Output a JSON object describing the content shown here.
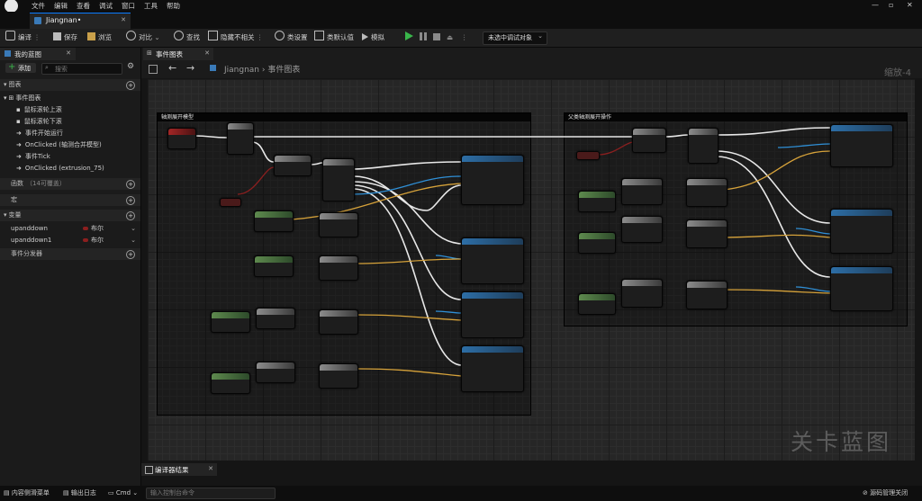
{
  "menu": [
    "文件",
    "编辑",
    "查看",
    "调试",
    "窗口",
    "工具",
    "帮助"
  ],
  "doc_tab": "Jiangnan•",
  "toolbar": {
    "compile": "编译",
    "save": "保存",
    "browse": "浏览",
    "diff": "对比",
    "find": "查找",
    "hide_unrelated": "隐藏不相关",
    "class_settings": "类设置",
    "class_defaults": "类默认值",
    "simulate": "模拟",
    "debug_target": "未选中调试对象"
  },
  "left_panel": {
    "tab_title": "我的蓝图",
    "add_label": "添加",
    "search_placeholder": "搜索",
    "section_graphs": "图表",
    "event_graph": "事件图表",
    "events": [
      "鼠标滚轮上滚",
      "鼠标滚轮下滚",
      "事件开始运行",
      "OnClicked (轴测合并模型)",
      "事件Tick",
      "OnClicked (extrusion_75)"
    ],
    "section_functions": "函数",
    "functions_hint": "（14可覆盖）",
    "section_macros": "宏",
    "section_variables": "变量",
    "variables": [
      {
        "name": "upanddown",
        "type": "布尔"
      },
      {
        "name": "upanddown1",
        "type": "布尔"
      }
    ],
    "section_dispatchers": "事件分发器"
  },
  "graph": {
    "tab_title": "事件图表",
    "breadcrumb_root": "Jiangnan",
    "breadcrumb_child": "事件图表",
    "zoom": "缩放-4",
    "comment_left": "轴测展开模型",
    "comment_right": "父类轴测展开操作",
    "watermark": "关卡蓝图"
  },
  "bottom_tab": "编译器结果",
  "status": {
    "content_drawer": "内容侧滑菜单",
    "output_log": "输出日志",
    "cmd": "Cmd",
    "console_placeholder": "输入控制台命令",
    "source_control": "源码管理关闭"
  },
  "colors": {
    "exec_wire": "#e8e8e8",
    "object_wire": "#2f8fd6",
    "vector_wire": "#d6a23a",
    "bool_wire": "#8c1f1f",
    "accent": "#0a7cff",
    "play_green": "#39b54a"
  }
}
